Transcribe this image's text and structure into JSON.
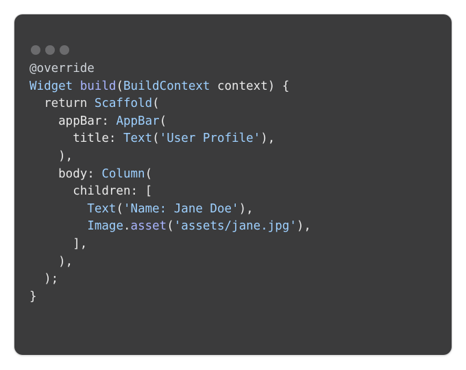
{
  "window": {
    "controls": [
      "window-dot",
      "window-dot",
      "window-dot"
    ]
  },
  "code": {
    "lines": [
      [
        {
          "t": "@override",
          "c": "annotation"
        }
      ],
      [
        {
          "t": "Widget",
          "c": "type"
        },
        {
          "t": " ",
          "c": "plain"
        },
        {
          "t": "build",
          "c": "method"
        },
        {
          "t": "(",
          "c": "plain"
        },
        {
          "t": "BuildContext",
          "c": "type"
        },
        {
          "t": " context) {",
          "c": "plain"
        }
      ],
      [
        {
          "t": "  return ",
          "c": "keyword"
        },
        {
          "t": "Scaffold",
          "c": "type"
        },
        {
          "t": "(",
          "c": "plain"
        }
      ],
      [
        {
          "t": "    appBar: ",
          "c": "plain"
        },
        {
          "t": "AppBar",
          "c": "type"
        },
        {
          "t": "(",
          "c": "plain"
        }
      ],
      [
        {
          "t": "      title: ",
          "c": "plain"
        },
        {
          "t": "Text",
          "c": "type"
        },
        {
          "t": "(",
          "c": "plain"
        },
        {
          "t": "'User Profile'",
          "c": "string"
        },
        {
          "t": "),",
          "c": "plain"
        }
      ],
      [
        {
          "t": "    ),",
          "c": "plain"
        }
      ],
      [
        {
          "t": "    body: ",
          "c": "plain"
        },
        {
          "t": "Column",
          "c": "type"
        },
        {
          "t": "(",
          "c": "plain"
        }
      ],
      [
        {
          "t": "      children: [",
          "c": "plain"
        }
      ],
      [
        {
          "t": "        ",
          "c": "plain"
        },
        {
          "t": "Text",
          "c": "type"
        },
        {
          "t": "(",
          "c": "plain"
        },
        {
          "t": "'Name: Jane Doe'",
          "c": "string"
        },
        {
          "t": "),",
          "c": "plain"
        }
      ],
      [
        {
          "t": "        ",
          "c": "plain"
        },
        {
          "t": "Image",
          "c": "type"
        },
        {
          "t": ".",
          "c": "plain"
        },
        {
          "t": "asset",
          "c": "method"
        },
        {
          "t": "(",
          "c": "plain"
        },
        {
          "t": "'assets/jane.jpg'",
          "c": "string"
        },
        {
          "t": "),",
          "c": "plain"
        }
      ],
      [
        {
          "t": "      ],",
          "c": "plain"
        }
      ],
      [
        {
          "t": "    ),",
          "c": "plain"
        }
      ],
      [
        {
          "t": "  );",
          "c": "plain"
        }
      ],
      [
        {
          "t": "}",
          "c": "plain"
        }
      ]
    ]
  }
}
